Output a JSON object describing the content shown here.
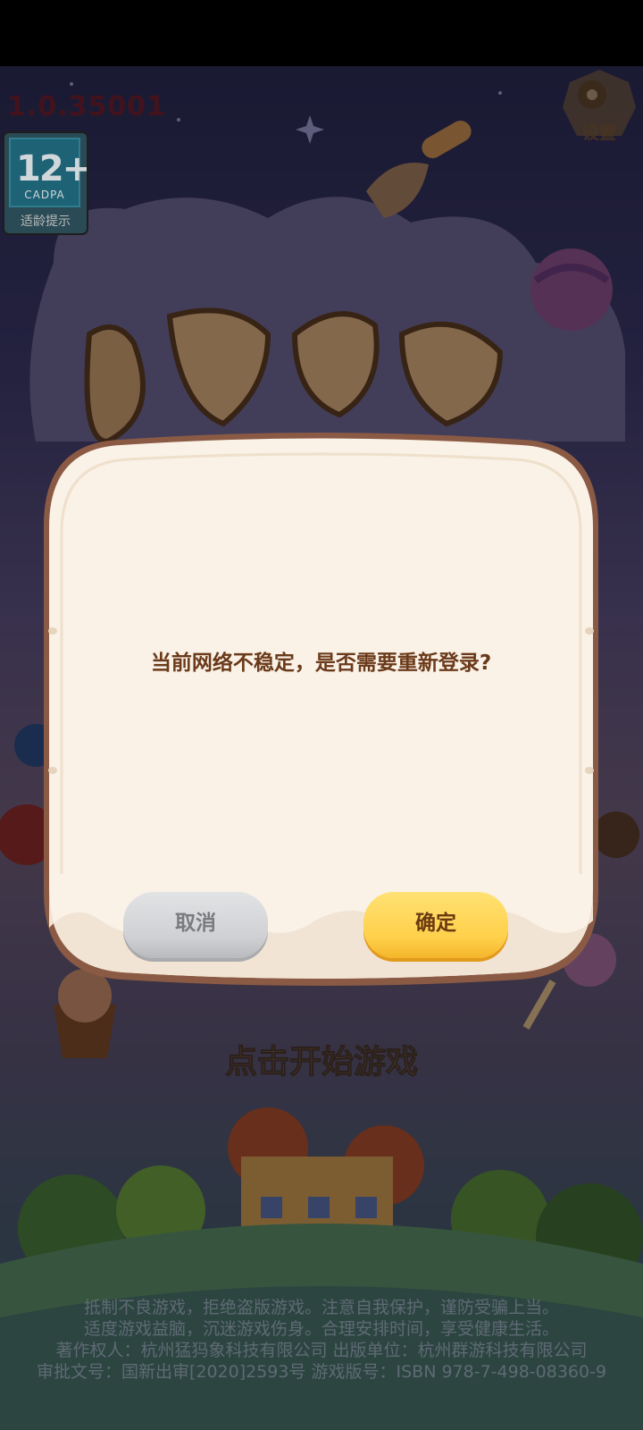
{
  "game": {
    "version": "1.0.35001",
    "settings_label": "设置",
    "age_rating": {
      "number": "12+",
      "org": "CADPA",
      "label": "适龄提示"
    },
    "start_prompt": "点击开始游戏",
    "footer_lines": [
      "抵制不良游戏，拒绝盗版游戏。注意自我保护，谨防受骗上当。",
      "适度游戏益脑，沉迷游戏伤身。合理安排时间，享受健康生活。",
      "著作权人：杭州猛犸象科技有限公司    出版单位：杭州群游科技有限公司",
      "审批文号：国新出审[2020]2593号    游戏版号：ISBN 978-7-498-08360-9"
    ]
  },
  "dialog": {
    "message": "当前网络不稳定，是否需要重新登录?",
    "cancel_label": "取消",
    "confirm_label": "确定"
  },
  "colors": {
    "dialog_bg": "#faf1e7",
    "dialog_border": "#8a5a44",
    "confirm_button": "#ffd04a",
    "cancel_button": "#d2d3d6",
    "message_text": "#6a3a1a"
  }
}
